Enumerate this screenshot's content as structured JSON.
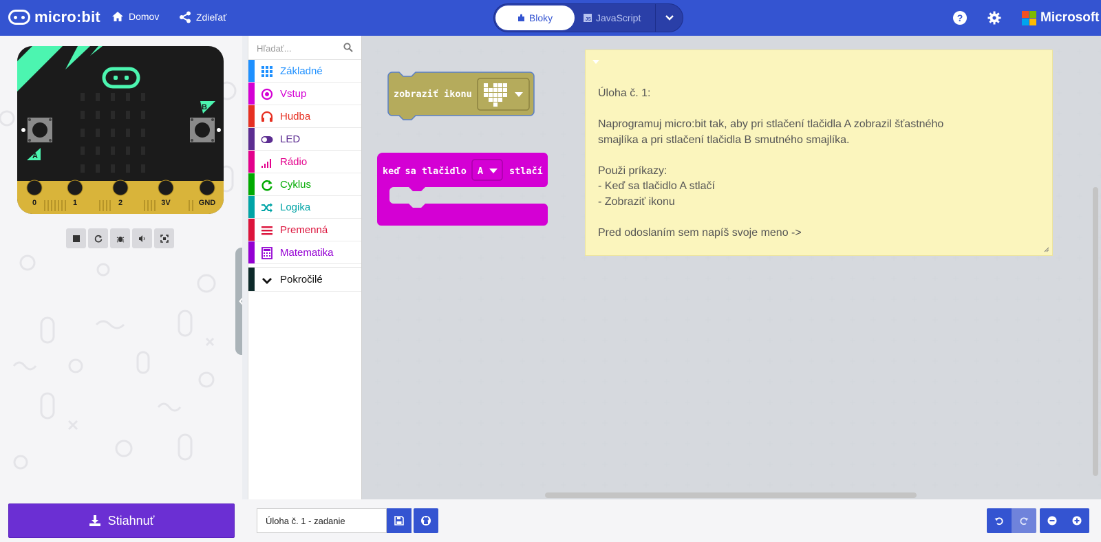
{
  "header": {
    "brand": "micro:bit",
    "home_label": "Domov",
    "share_label": "Zdieľať",
    "mode_blocks_label": "Bloky",
    "mode_js_label": "JavaScript",
    "microsoft_label": "Microsoft",
    "help_symbol": "?",
    "icons": [
      "microbit-logo-icon",
      "home-icon",
      "share-icon",
      "puzzle-icon",
      "js-icon",
      "chevron-down-icon",
      "help-icon",
      "gear-icon",
      "microsoft-logo-icon"
    ]
  },
  "simulator": {
    "pins": [
      "0",
      "1",
      "2",
      "3V",
      "GND"
    ],
    "button_a_label": "A",
    "button_b_label": "B",
    "controls": [
      "stop-icon",
      "restart-icon",
      "debug-icon",
      "sound-icon",
      "fullscreen-icon"
    ]
  },
  "toolbox": {
    "search_placeholder": "Hľadať...",
    "categories": [
      {
        "label": "Základné",
        "color": "#1e90ff",
        "icon": "grid-icon"
      },
      {
        "label": "Vstup",
        "color": "#d400d4",
        "icon": "target-icon"
      },
      {
        "label": "Hudba",
        "color": "#e63022",
        "icon": "headphones-icon"
      },
      {
        "label": "LED",
        "color": "#5c2d91",
        "icon": "toggle-icon"
      },
      {
        "label": "Rádio",
        "color": "#e3008c",
        "icon": "signal-icon"
      },
      {
        "label": "Cyklus",
        "color": "#00aa00",
        "icon": "refresh-icon"
      },
      {
        "label": "Logika",
        "color": "#00a4a6",
        "icon": "shuffle-icon"
      },
      {
        "label": "Premenná",
        "color": "#dc143c",
        "icon": "list-icon"
      },
      {
        "label": "Matematika",
        "color": "#9400d3",
        "icon": "calculator-icon"
      }
    ],
    "advanced_label": "Pokročilé"
  },
  "workspace": {
    "show_icon_block": {
      "label": "zobraziť ikonu",
      "color": "#b5ab5c"
    },
    "button_event_block": {
      "prefix": "keď sa tlačidlo",
      "button_value": "A",
      "suffix": "stlačí",
      "color": "#d400d4"
    },
    "note": {
      "text": "Úloha č. 1:\n\nNaprogramuj micro:bit tak, aby pri stlačení tlačidla A zobrazil šťastného\nsmajlíka a pri stlačení tlačidla B smutného smajlíka.\n\nPouži príkazy:\n- Keď sa tlačidlo A stlačí\n- Zobraziť ikonu\n\nPred odoslaním sem napíš svoje meno ->"
    }
  },
  "footer": {
    "download_label": "Stiahnuť",
    "project_name": "Úloha č. 1 - zadanie",
    "icons": [
      "download-icon",
      "save-icon",
      "github-icon",
      "undo-icon",
      "redo-icon",
      "zoom-out-icon",
      "zoom-in-icon"
    ]
  },
  "colors": {
    "header_bg": "#3454d1",
    "download_bg": "#6b2fd3",
    "note_bg": "#fbf5bd",
    "board_bg": "#1b1b1b",
    "board_accent": "#4cf5b0",
    "pin_gold": "#d9b43a"
  }
}
